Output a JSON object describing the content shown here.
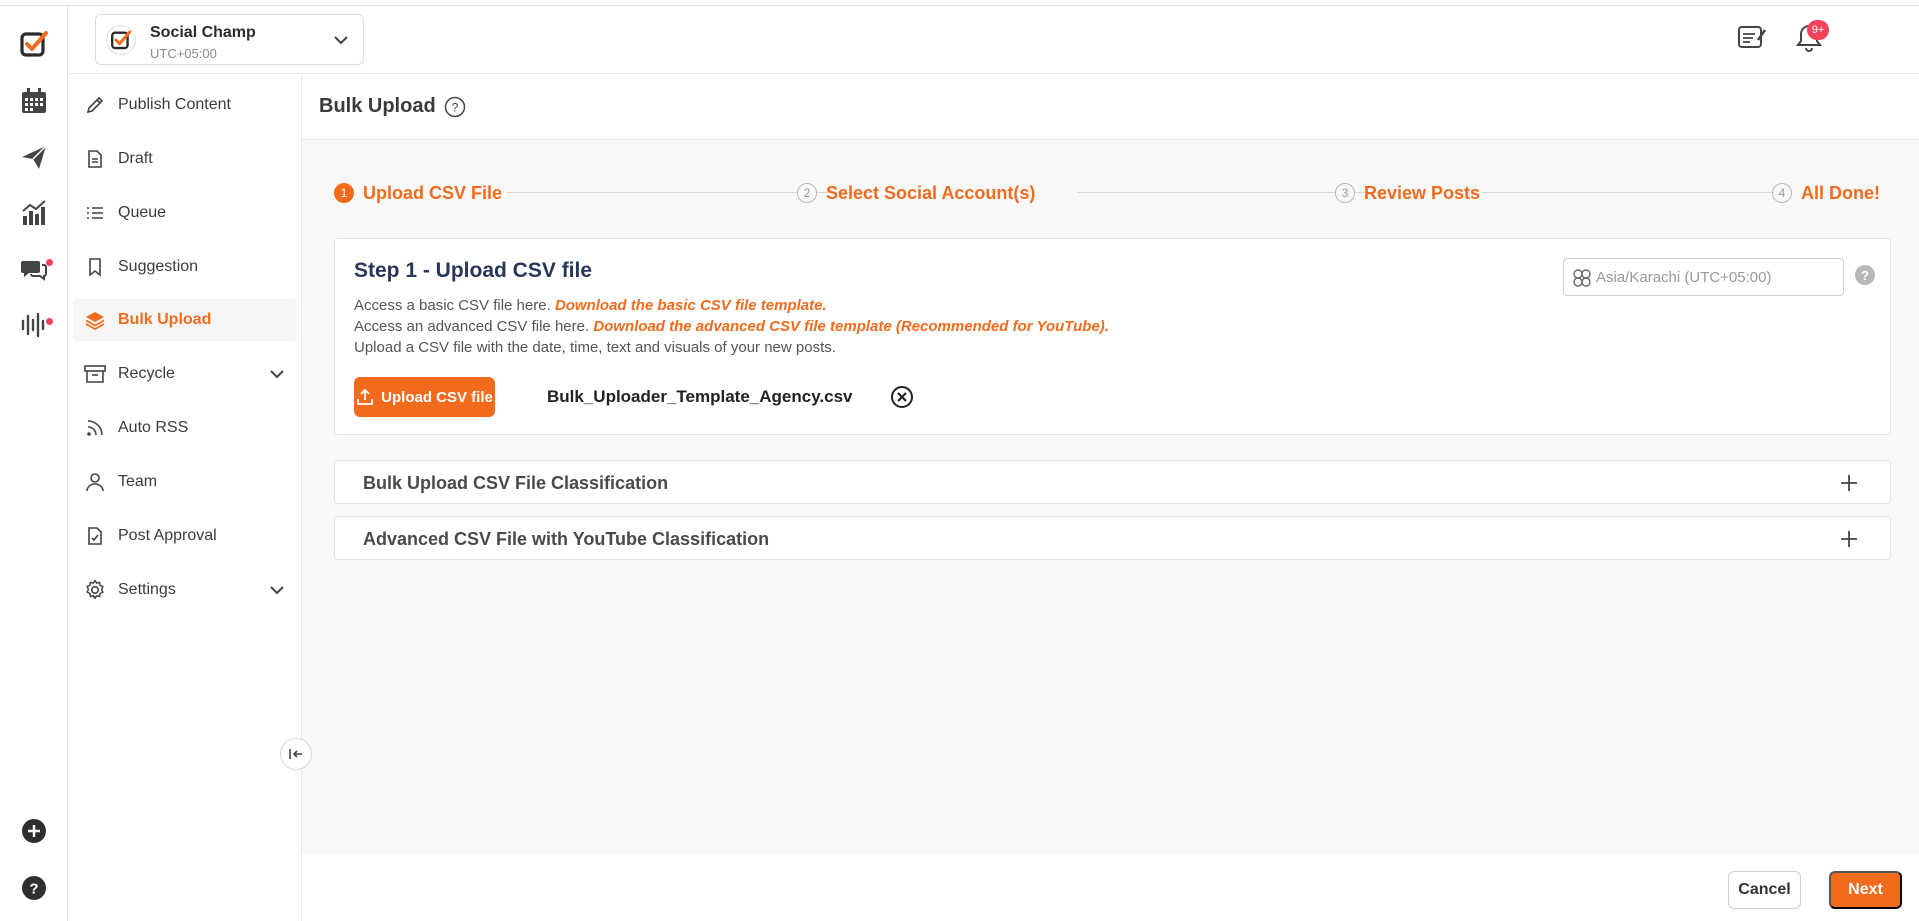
{
  "workspace": {
    "name": "Social Champ",
    "timezone": "UTC+05:00"
  },
  "header": {
    "notification_count": "9+"
  },
  "sidebar": {
    "items": [
      {
        "label": "Publish Content",
        "icon": "pencil-icon"
      },
      {
        "label": "Draft",
        "icon": "document-icon"
      },
      {
        "label": "Queue",
        "icon": "list-icon"
      },
      {
        "label": "Suggestion",
        "icon": "bookmark-icon"
      },
      {
        "label": "Bulk Upload",
        "icon": "layers-icon",
        "active": true
      },
      {
        "label": "Recycle",
        "icon": "archive-icon",
        "expandable": true
      },
      {
        "label": "Auto RSS",
        "icon": "rss-icon"
      },
      {
        "label": "Team",
        "icon": "user-icon"
      },
      {
        "label": "Post Approval",
        "icon": "approval-doc-icon"
      },
      {
        "label": "Settings",
        "icon": "gear-icon",
        "expandable": true
      }
    ]
  },
  "page": {
    "title": "Bulk Upload"
  },
  "stepper": {
    "steps": [
      {
        "num": "1",
        "label": "Upload CSV File",
        "active": true
      },
      {
        "num": "2",
        "label": "Select Social Account(s)"
      },
      {
        "num": "3",
        "label": "Review Posts"
      },
      {
        "num": "4",
        "label": "All Done!"
      }
    ]
  },
  "step_card": {
    "title": "Step 1 - Upload CSV file",
    "line1_text": "Access a basic CSV file here.",
    "line1_link": "Download the basic CSV file template.",
    "line2_text": "Access an advanced CSV file here.",
    "line2_link": "Download the advanced CSV file template (Recommended for YouTube).",
    "line3_text": "Upload a CSV file with the date, time, text and visuals of your new posts.",
    "upload_button": "Upload CSV file",
    "file_name": "Bulk_Uploader_Template_Agency.csv",
    "timezone_placeholder": "Asia/Karachi (UTC+05:00)",
    "help_glyph": "?"
  },
  "accordions": [
    {
      "label": "Bulk Upload CSV File Classification"
    },
    {
      "label": "Advanced CSV File with YouTube Classification"
    }
  ],
  "footer": {
    "cancel_label": "Cancel",
    "next_label": "Next"
  },
  "colors": {
    "accent": "#f26b1d",
    "badge": "#f2435a",
    "title_navy": "#27365a"
  }
}
